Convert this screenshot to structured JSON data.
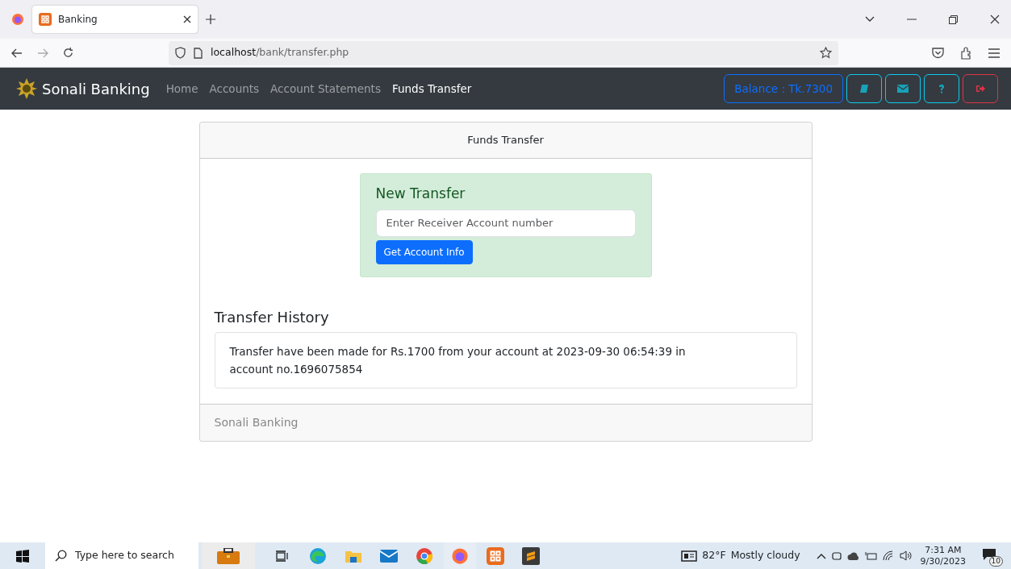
{
  "browser": {
    "tab_title": "Banking",
    "url_host": "localhost",
    "url_path": "/bank/transfer.php"
  },
  "navbar": {
    "brand": "Sonali Banking",
    "links": [
      {
        "label": "Home",
        "selected": false
      },
      {
        "label": "Accounts",
        "selected": false
      },
      {
        "label": "Account Statements",
        "selected": false
      },
      {
        "label": "Funds Transfer",
        "selected": true
      }
    ],
    "balance": "Balance : Tk.7300",
    "icon_buttons": [
      {
        "kind": "book"
      },
      {
        "kind": "mail"
      },
      {
        "kind": "help"
      },
      {
        "kind": "logout"
      }
    ]
  },
  "card": {
    "header": "Funds Transfer",
    "new_transfer": {
      "title": "New Transfer",
      "placeholder": "Enter Receiver Account number",
      "button": "Get Account Info"
    },
    "history_title": "Transfer History",
    "history": [
      "Transfer have been made for Rs.1700 from your account at 2023-09-30 06:54:39 in account no.1696075854"
    ],
    "footer": "Sonali Banking"
  },
  "taskbar": {
    "search_placeholder": "Type here to search",
    "temperature": "82°F",
    "weather": "Mostly cloudy",
    "time": "7:31 AM",
    "date": "9/30/2023",
    "notifications": "10"
  }
}
